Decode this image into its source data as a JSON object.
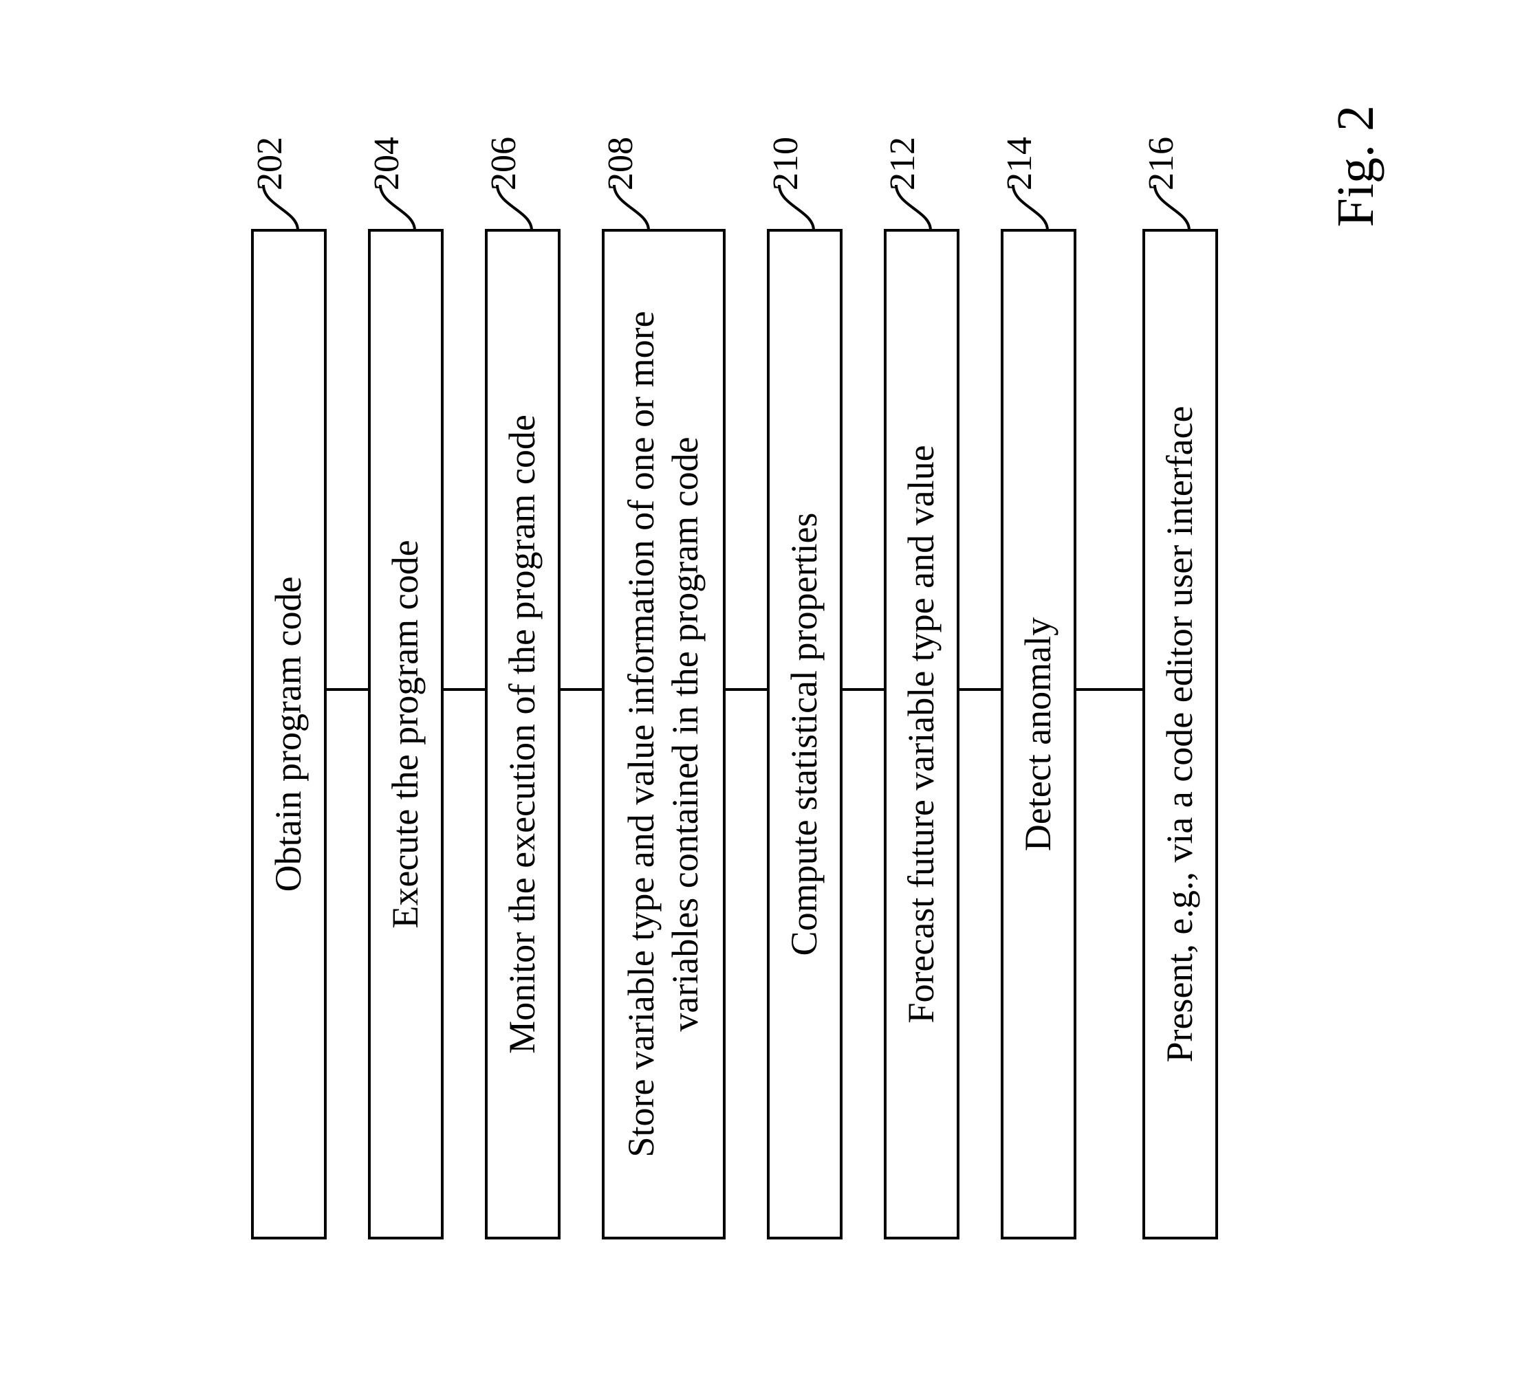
{
  "steps": [
    {
      "id": "202",
      "text": "Obtain program code",
      "lines": 1
    },
    {
      "id": "204",
      "text": "Execute the program code",
      "lines": 1
    },
    {
      "id": "206",
      "text": "Monitor the execution of the program code",
      "lines": 1
    },
    {
      "id": "208",
      "text": "Store variable type and value information of one or more variables contained in the program code",
      "lines": 2
    },
    {
      "id": "210",
      "text": "Compute statistical properties",
      "lines": 1
    },
    {
      "id": "212",
      "text": "Forecast future variable type and value",
      "lines": 1
    },
    {
      "id": "214",
      "text": "Detect anomaly",
      "lines": 1
    },
    {
      "id": "216",
      "text": "Present, e.g., via a code editor user interface",
      "lines": 1
    }
  ],
  "figure_label": "Fig. 2"
}
